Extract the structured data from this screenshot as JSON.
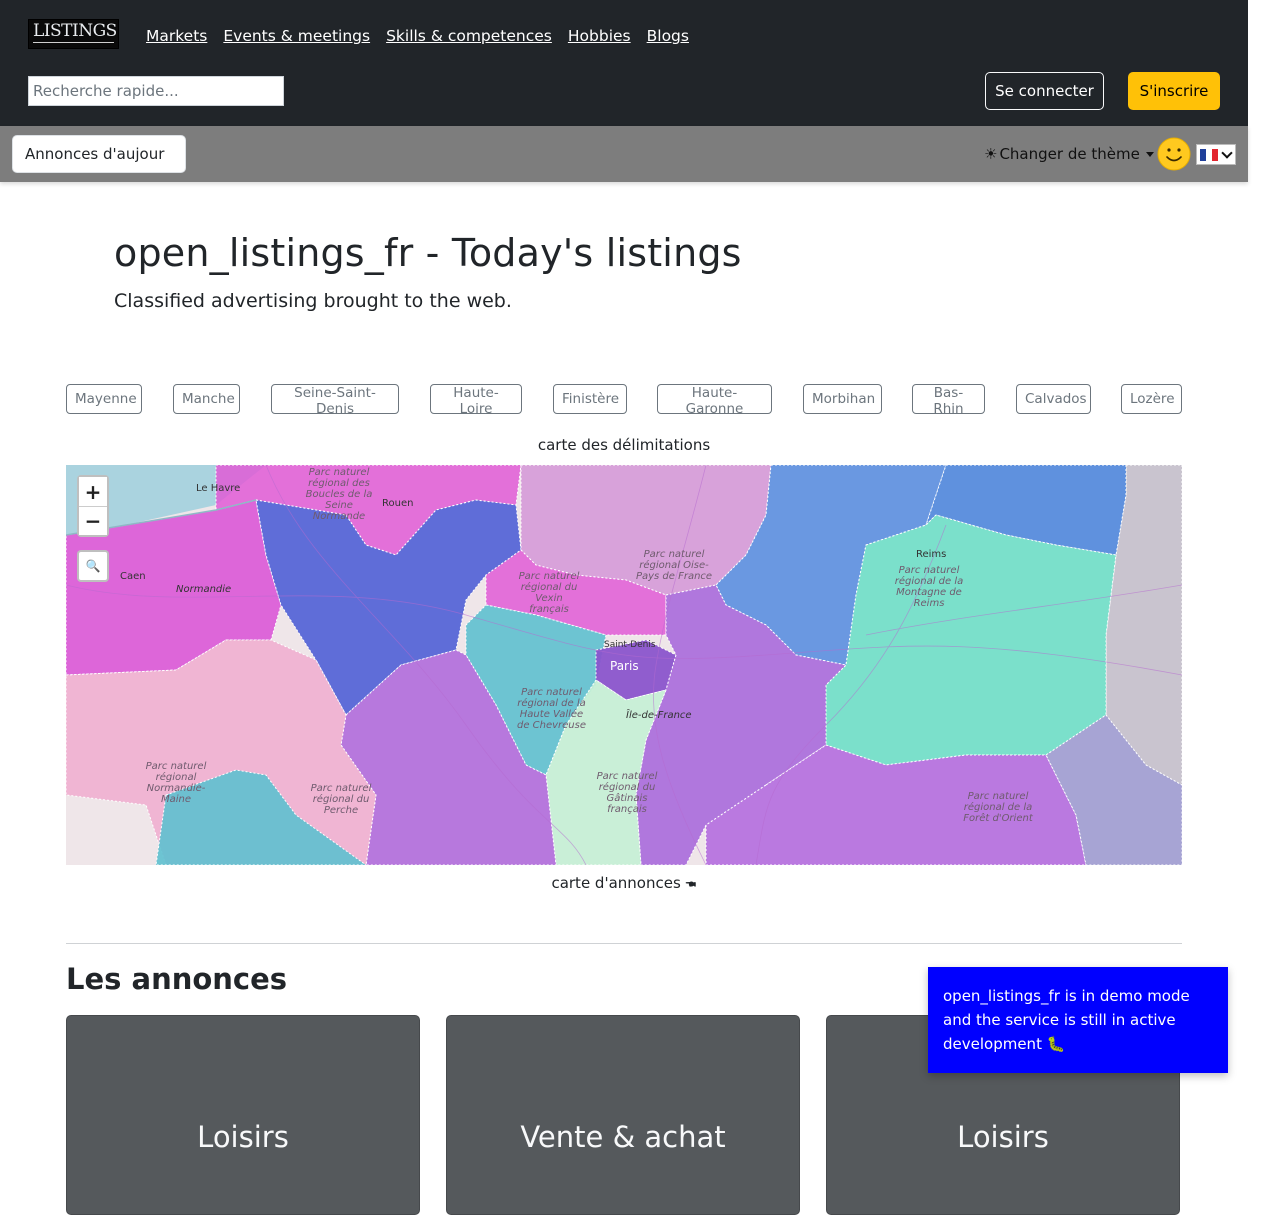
{
  "header": {
    "logo_text": "LISTINGS",
    "nav": [
      "Markets",
      "Events & meetings",
      "Skills & competences",
      "Hobbies",
      "Blogs"
    ],
    "search_placeholder": "Recherche rapide...",
    "login_label": "Se connecter",
    "signup_label": "S'inscrire"
  },
  "subbar": {
    "today_label": "Annonces d'aujour",
    "theme_label": "Changer de thème",
    "theme_icon": "☀",
    "language": "fr"
  },
  "hero": {
    "title": "open_listings_fr - Today's listings",
    "subtitle": "Classified advertising brought to the web."
  },
  "regions": [
    "Mayenne",
    "Manche",
    "Seine-Saint-Denis",
    "Haute-Loire",
    "Finistère",
    "Haute-Garonne",
    "Morbihan",
    "Bas-Rhin",
    "Calvados",
    "Lozère"
  ],
  "map": {
    "caption_top": "carte des délimitations",
    "caption_bottom": "carte d'annonces 🖜",
    "zoom_in": "+",
    "zoom_out": "−",
    "search_icon": "🔍",
    "cities": [
      "Le Havre",
      "Rouen",
      "Caen",
      "Normandie",
      "Reims",
      "Paris",
      "Saint-Denis",
      "Île-de-France"
    ],
    "park_labels": [
      "Parc naturel régional des Boucles de la Seine Normande",
      "Parc naturel régional Oise-Pays de France",
      "Parc naturel régional du Vexin français",
      "Parc naturel régional de la Montagne de Reims",
      "Parc naturel régional de la Haute Vallée de Chevreuse",
      "Parc naturel régional du Gâtinais français",
      "Parc naturel régional Normandie-Maine",
      "Parc naturel régional du Perche",
      "Parc naturel régional de la Forêt d'Orient"
    ],
    "colors": {
      "magenta": "#d94fd6",
      "blue": "#4f5fd6",
      "sky": "#5b8fe0",
      "teal": "#71e0c8",
      "lilac": "#d59ad8",
      "purple": "#a86adb",
      "pink": "#efb2d2",
      "cyan": "#5ec0cf",
      "mint": "#c6efd6",
      "grey": "#c9c4cf"
    }
  },
  "listings": {
    "title": "Les annonces",
    "cards": [
      "Loisirs",
      "Vente & achat",
      "Loisirs"
    ]
  },
  "toast": {
    "message": "open_listings_fr is in demo mode and the service is still in active development 🐛"
  }
}
